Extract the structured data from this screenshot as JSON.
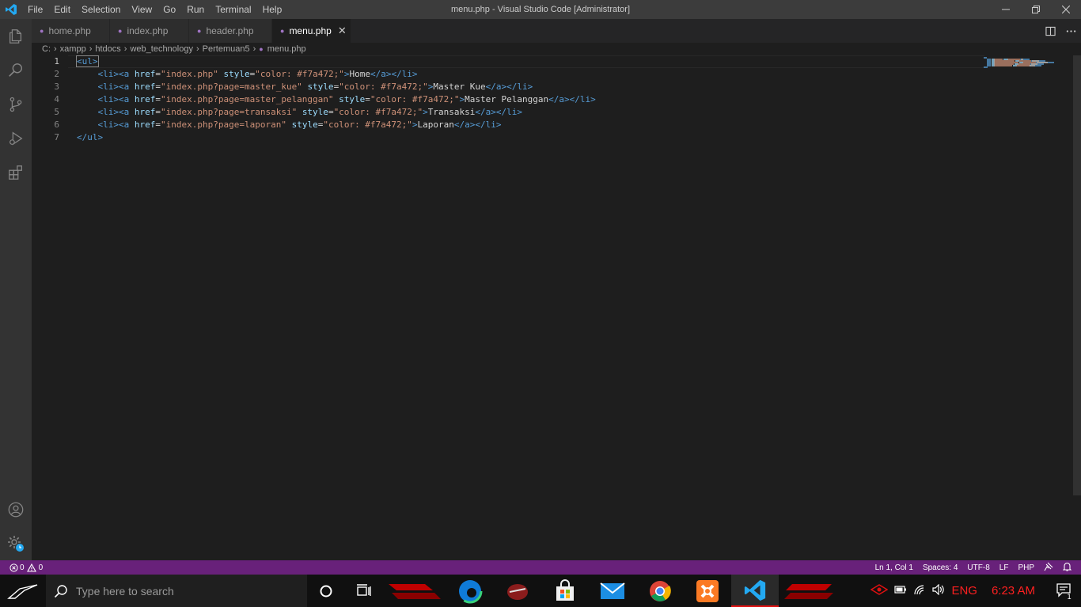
{
  "window": {
    "title": "menu.php - Visual Studio Code [Administrator]",
    "menu": [
      "File",
      "Edit",
      "Selection",
      "View",
      "Go",
      "Run",
      "Terminal",
      "Help"
    ]
  },
  "tabs": [
    {
      "label": "home.php",
      "active": false
    },
    {
      "label": "index.php",
      "active": false
    },
    {
      "label": "header.php",
      "active": false
    },
    {
      "label": "menu.php",
      "active": true
    }
  ],
  "breadcrumb": [
    "C:",
    "xampp",
    "htdocs",
    "web_technology",
    "Pertemuan5",
    "menu.php"
  ],
  "editor": {
    "line_numbers": [
      "1",
      "2",
      "3",
      "4",
      "5",
      "6",
      "7"
    ],
    "lines": [
      [
        {
          "t": "tag",
          "v": "<ul>"
        }
      ],
      [
        {
          "t": "txt",
          "v": "    "
        },
        {
          "t": "tag",
          "v": "<li><a"
        },
        {
          "t": "txt",
          "v": " "
        },
        {
          "t": "attr",
          "v": "href"
        },
        {
          "t": "txt",
          "v": "="
        },
        {
          "t": "str",
          "v": "\"index.php\""
        },
        {
          "t": "txt",
          "v": " "
        },
        {
          "t": "attr",
          "v": "style"
        },
        {
          "t": "txt",
          "v": "="
        },
        {
          "t": "str",
          "v": "\"color: #f7a472;\""
        },
        {
          "t": "tag",
          "v": ">"
        },
        {
          "t": "txt",
          "v": "Home"
        },
        {
          "t": "tag",
          "v": "</a></li>"
        }
      ],
      [
        {
          "t": "txt",
          "v": "    "
        },
        {
          "t": "tag",
          "v": "<li><a"
        },
        {
          "t": "txt",
          "v": " "
        },
        {
          "t": "attr",
          "v": "href"
        },
        {
          "t": "txt",
          "v": "="
        },
        {
          "t": "str",
          "v": "\"index.php?page=master_kue\""
        },
        {
          "t": "txt",
          "v": " "
        },
        {
          "t": "attr",
          "v": "style"
        },
        {
          "t": "txt",
          "v": "="
        },
        {
          "t": "str",
          "v": "\"color: #f7a472;\""
        },
        {
          "t": "tag",
          "v": ">"
        },
        {
          "t": "txt",
          "v": "Master Kue"
        },
        {
          "t": "tag",
          "v": "</a></li>"
        }
      ],
      [
        {
          "t": "txt",
          "v": "    "
        },
        {
          "t": "tag",
          "v": "<li><a"
        },
        {
          "t": "txt",
          "v": " "
        },
        {
          "t": "attr",
          "v": "href"
        },
        {
          "t": "txt",
          "v": "="
        },
        {
          "t": "str",
          "v": "\"index.php?page=master_pelanggan\""
        },
        {
          "t": "txt",
          "v": " "
        },
        {
          "t": "attr",
          "v": "style"
        },
        {
          "t": "txt",
          "v": "="
        },
        {
          "t": "str",
          "v": "\"color: #f7a472;\""
        },
        {
          "t": "tag",
          "v": ">"
        },
        {
          "t": "txt",
          "v": "Master Pelanggan"
        },
        {
          "t": "tag",
          "v": "</a></li>"
        }
      ],
      [
        {
          "t": "txt",
          "v": "    "
        },
        {
          "t": "tag",
          "v": "<li><a"
        },
        {
          "t": "txt",
          "v": " "
        },
        {
          "t": "attr",
          "v": "href"
        },
        {
          "t": "txt",
          "v": "="
        },
        {
          "t": "str",
          "v": "\"index.php?page=transaksi\""
        },
        {
          "t": "txt",
          "v": " "
        },
        {
          "t": "attr",
          "v": "style"
        },
        {
          "t": "txt",
          "v": "="
        },
        {
          "t": "str",
          "v": "\"color: #f7a472;\""
        },
        {
          "t": "tag",
          "v": ">"
        },
        {
          "t": "txt",
          "v": "Transaksi"
        },
        {
          "t": "tag",
          "v": "</a></li>"
        }
      ],
      [
        {
          "t": "txt",
          "v": "    "
        },
        {
          "t": "tag",
          "v": "<li><a"
        },
        {
          "t": "txt",
          "v": " "
        },
        {
          "t": "attr",
          "v": "href"
        },
        {
          "t": "txt",
          "v": "="
        },
        {
          "t": "str",
          "v": "\"index.php?page=laporan\""
        },
        {
          "t": "txt",
          "v": " "
        },
        {
          "t": "attr",
          "v": "style"
        },
        {
          "t": "txt",
          "v": "="
        },
        {
          "t": "str",
          "v": "\"color: #f7a472;\""
        },
        {
          "t": "tag",
          "v": ">"
        },
        {
          "t": "txt",
          "v": "Laporan"
        },
        {
          "t": "tag",
          "v": "</a></li>"
        }
      ],
      [
        {
          "t": "tag",
          "v": "</ul>"
        }
      ]
    ]
  },
  "statusbar": {
    "errors": "0",
    "warnings": "0",
    "position": "Ln 1, Col 1",
    "spaces": "Spaces: 4",
    "encoding": "UTF-8",
    "eol": "LF",
    "language": "PHP"
  },
  "taskbar": {
    "search_placeholder": "Type here to search",
    "language": "ENG",
    "time": "6:23 AM",
    "notification_count": "1"
  },
  "colors": {
    "statusbar": "#68217a",
    "titlebar": "#3c3c3c",
    "activitybar": "#333333",
    "editor_bg": "#1e1e1e",
    "tag": "#569cd6",
    "attr": "#9cdcfe",
    "string": "#ce9178",
    "vscode_blue": "#23a9f2"
  }
}
